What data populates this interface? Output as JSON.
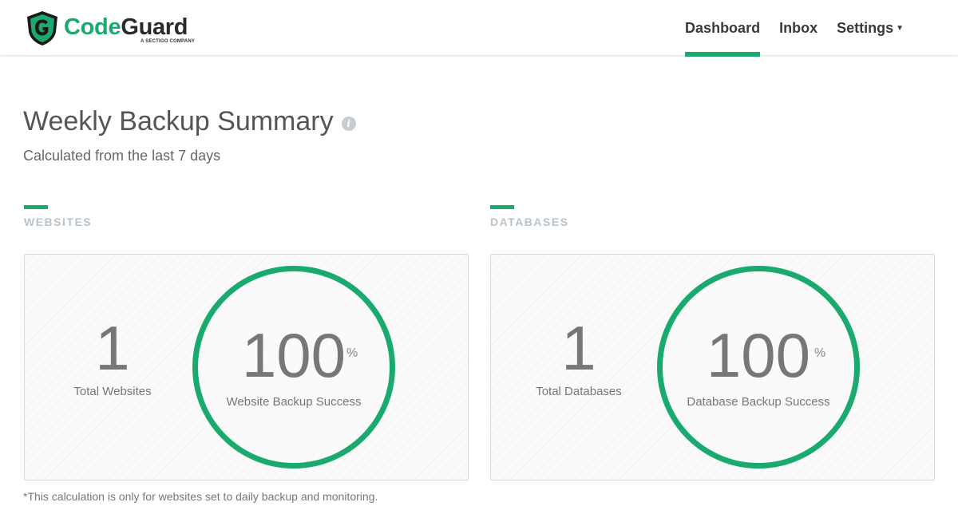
{
  "header": {
    "logo": {
      "name_part1": "Code",
      "name_part2": "Guard",
      "tagline": "A SECTIGO COMPANY"
    },
    "nav": [
      {
        "label": "Dashboard",
        "active": true
      },
      {
        "label": "Inbox",
        "active": false
      },
      {
        "label": "Settings",
        "active": false,
        "has_dropdown": true
      }
    ]
  },
  "page": {
    "title": "Weekly Backup Summary",
    "title_icon": "info-icon",
    "subtitle": "Calculated from the last 7 days"
  },
  "websites": {
    "section_label": "WEBSITES",
    "total_value": "1",
    "total_label": "Total Websites",
    "success_value": "100",
    "success_unit": "%",
    "success_label": "Website Backup Success"
  },
  "databases": {
    "section_label": "DATABASES",
    "total_value": "1",
    "total_label": "Total Databases",
    "success_value": "100",
    "success_unit": "%",
    "success_label": "Database Backup Success"
  },
  "footnote": "*This calculation is only for websites set to daily backup and monitoring.",
  "colors": {
    "accent": "#1aaa6e",
    "section_label": "#b9c2ca",
    "text": "#555555"
  }
}
